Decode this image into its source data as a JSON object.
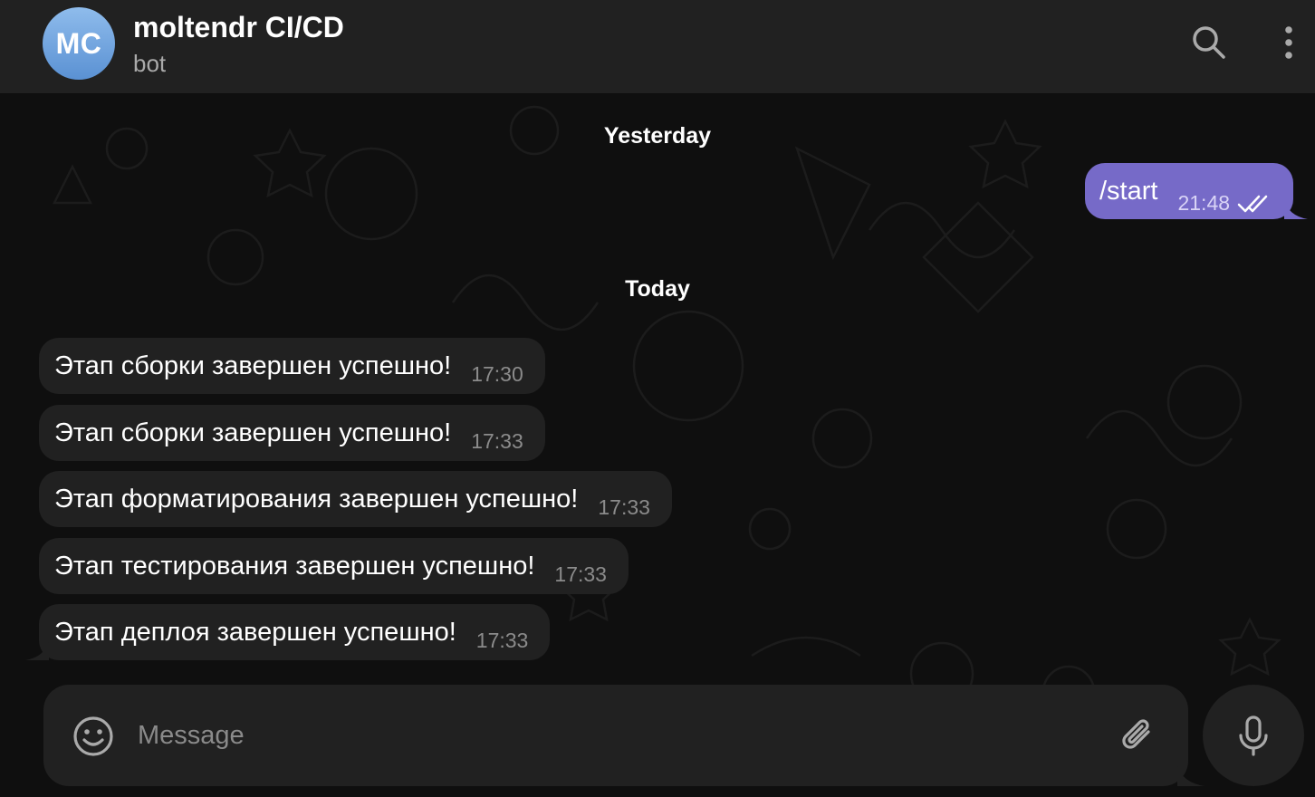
{
  "header": {
    "avatar_initials": "MC",
    "title": "moltendr CI/CD",
    "subtitle": "bot",
    "search_icon": "search-icon",
    "menu_icon": "more-vertical-icon"
  },
  "dates": {
    "yesterday": "Yesterday",
    "today": "Today"
  },
  "outgoing": [
    {
      "text": "/start",
      "time": "21:48",
      "status": "double-check-icon"
    }
  ],
  "incoming": [
    {
      "text": "Этап сборки завершен успешно!",
      "time": "17:30"
    },
    {
      "text": "Этап сборки завершен успешно!",
      "time": "17:33"
    },
    {
      "text": "Этап форматирования завершен успешно!",
      "time": "17:33"
    },
    {
      "text": "Этап тестирования завершен успешно!",
      "time": "17:33"
    },
    {
      "text": "Этап деплоя завершен успешно!",
      "time": "17:33"
    }
  ],
  "composer": {
    "placeholder": "Message",
    "emoji_icon": "emoji-icon",
    "attach_icon": "paperclip-icon",
    "mic_icon": "microphone-icon"
  },
  "colors": {
    "background": "#0f0f0f",
    "panel": "#212121",
    "outgoing_bubble": "#766ac8",
    "secondary_text": "#aaaaaa"
  }
}
